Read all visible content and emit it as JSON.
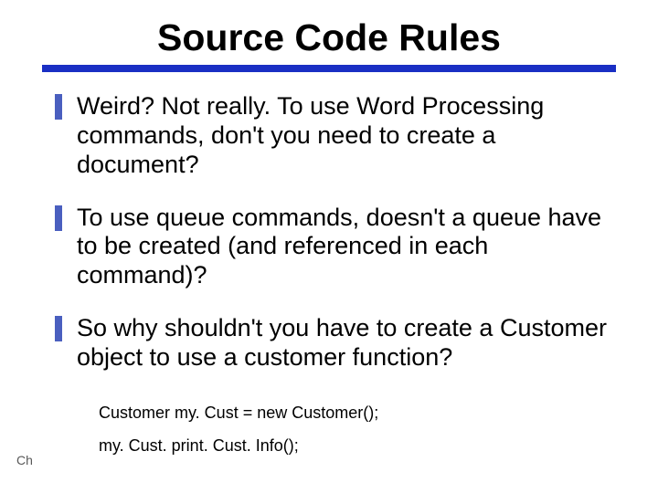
{
  "title": "Source Code Rules",
  "bullets": [
    "Weird? Not really.  To use Word Processing commands, don't you need to create a document?",
    "To use queue commands, doesn't a queue have to be created (and referenced in each command)?",
    "So why shouldn't you have to create a Customer object to use a customer function?"
  ],
  "code": {
    "line1": "Customer  my. Cust  =  new  Customer();",
    "line2": "my. Cust. print. Cust. Info();"
  },
  "footer": "Ch"
}
